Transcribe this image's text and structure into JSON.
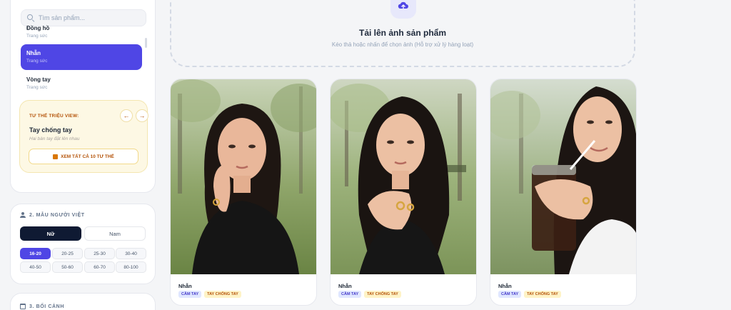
{
  "search": {
    "placeholder": "Tìm sản phẩm..."
  },
  "categories": [
    {
      "name": "Đồng hồ",
      "sub": "Trang sức"
    },
    {
      "name": "Nhẫn",
      "sub": "Trang sức",
      "active": true
    },
    {
      "name": "Vòng tay",
      "sub": "Trang sức"
    }
  ],
  "pose": {
    "label": "TƯ THẾ TRIỆU VIEW:",
    "title": "Tay chống tay",
    "sub": "Hai bàn tay đặt lên nhau",
    "view_all": "XEM TẤT CẢ 10 TƯ THẾ",
    "prev_icon": "arrow-left-icon",
    "next_icon": "arrow-right-icon"
  },
  "model": {
    "heading": "2. MẪU NGƯỜI VIỆT",
    "female": "Nữ",
    "male": "Nam",
    "ages": [
      "16-20",
      "20-25",
      "25-30",
      "30-40",
      "40-50",
      "50-60",
      "60-70",
      "80-100"
    ],
    "active_age": "16-20"
  },
  "background": {
    "heading": "3. BỐI CẢNH"
  },
  "upload": {
    "title": "Tải lên ảnh sản phẩm",
    "subtitle": "Kéo thả hoặc nhấn để chọn ảnh (Hỗ trợ xử lý hàng loạt)",
    "icon": "cloud-upload-icon"
  },
  "results": [
    {
      "name": "Nhẫn",
      "tags": [
        "CẦM TAY",
        "TAY CHỐNG TAY"
      ]
    },
    {
      "name": "Nhẫn",
      "tags": [
        "CẦM TAY",
        "TAY CHỐNG TAY"
      ]
    },
    {
      "name": "Nhẫn",
      "tags": [
        "CẦM TAY",
        "TAY CHỐNG TAY"
      ]
    }
  ],
  "colors": {
    "accent": "#4f46e5",
    "dark": "#0f1a33",
    "amber": "#b45309",
    "pose_bg": "#fdf8e4"
  }
}
